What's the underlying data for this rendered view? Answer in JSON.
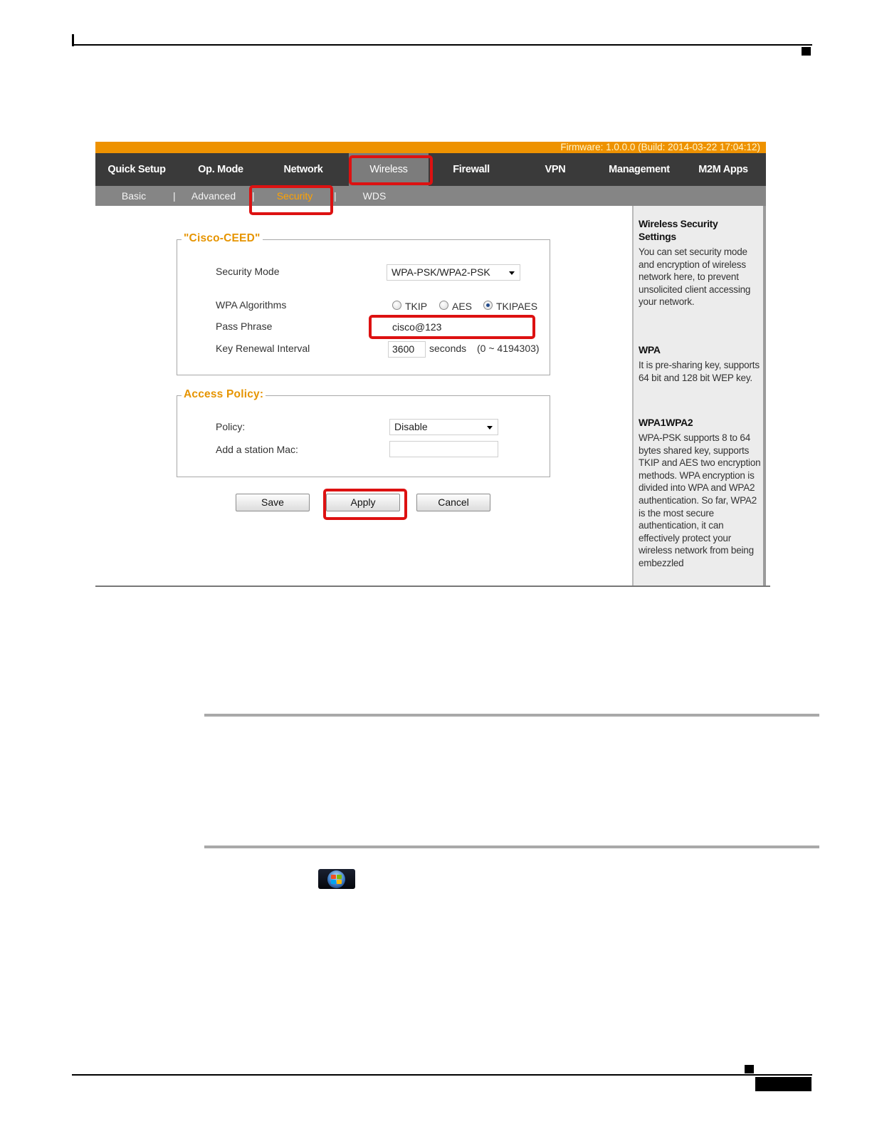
{
  "firmware": "Firmware: 1.0.0.0 (Build: 2014-03-22 17:04:12)",
  "nav": {
    "items": [
      "Quick Setup",
      "Op. Mode",
      "Network",
      "Wireless",
      "Firewall",
      "VPN",
      "Management",
      "M2M Apps"
    ],
    "active": "Wireless"
  },
  "subnav": {
    "items": [
      "Basic",
      "Advanced",
      "Security",
      "WDS"
    ],
    "separator": "|",
    "active": "Security"
  },
  "ssid_section": {
    "legend": "\"Cisco-CEED\"",
    "security_mode": {
      "label": "Security Mode",
      "value": "WPA-PSK/WPA2-PSK"
    },
    "wpa_algorithms": {
      "label": "WPA Algorithms",
      "options": [
        "TKIP",
        "AES",
        "TKIPAES"
      ],
      "selected": "TKIPAES"
    },
    "pass_phrase": {
      "label": "Pass Phrase",
      "value": "cisco@123"
    },
    "key_renewal": {
      "label": "Key Renewal Interval",
      "value": "3600",
      "unit": "seconds",
      "range": "(0 ~ 4194303)"
    }
  },
  "access_policy": {
    "legend": "Access Policy:",
    "policy": {
      "label": "Policy:",
      "value": "Disable"
    },
    "station_mac": {
      "label": "Add a station Mac:",
      "value": ""
    }
  },
  "buttons": {
    "save": "Save",
    "apply": "Apply",
    "cancel": "Cancel"
  },
  "help": {
    "sections": [
      {
        "title": "Wireless Security Settings",
        "body": "You can set security mode and encryption of wireless network here, to prevent unsolicited client accessing your network."
      },
      {
        "title": "WPA",
        "body": "It is pre-sharing key, supports 64 bit and 128 bit WEP key."
      },
      {
        "title": "WPA1WPA2",
        "body": "WPA-PSK supports 8 to 64 bytes shared key, supports TKIP and AES two encryption methods. WPA encryption is divided into WPA and WPA2 authentication. So far, WPA2 is the most secure authentication, it can effectively protect your wireless network from being embezzled"
      }
    ]
  },
  "colors": {
    "accent": "#ee9200",
    "nav_bg": "#3a3a3a",
    "highlight": "#dd1111"
  }
}
